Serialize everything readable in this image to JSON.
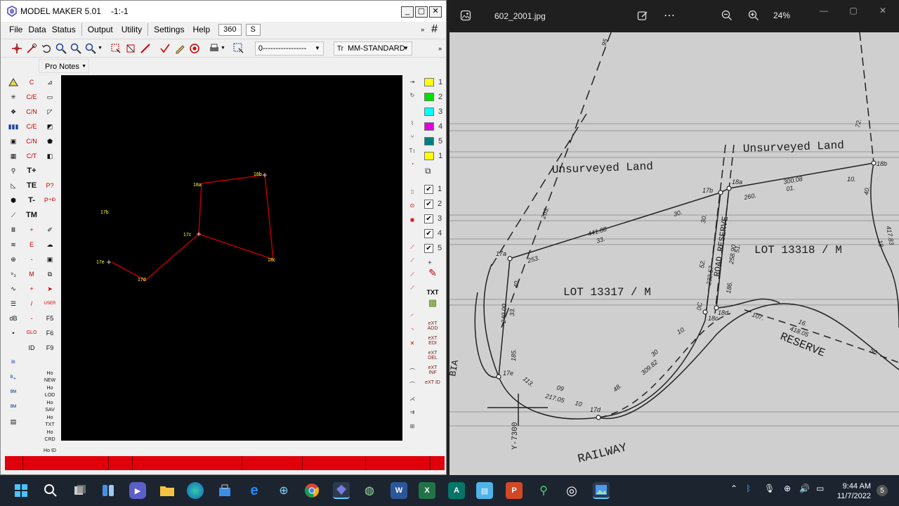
{
  "model_maker": {
    "title": "MODEL MAKER  5.01",
    "title_extra": "-1:-1",
    "window_buttons": [
      "_",
      "▢",
      "✕"
    ],
    "menu": [
      "File",
      "Data",
      "Status",
      "Output",
      "Utility",
      "Settings",
      "Help"
    ],
    "menu_box_1": "360",
    "menu_box_2": "S",
    "layer_combo": "0-----------------",
    "style_combo": "MM-STANDARD",
    "pro_notes": "Pro Notes",
    "left_tools_col2": [
      "C",
      "C/E",
      "C/N",
      "C/E",
      "C/N",
      "C/T",
      "T+",
      "TE",
      "T-",
      "TM",
      "+",
      "E",
      "-",
      "M",
      "+",
      "/",
      "-",
      "GLO",
      "ID"
    ],
    "left_tools_col3": [
      "Ho NEW",
      "Ho LOD",
      "Ho SAV",
      "Ho TXT",
      "Ho CRD",
      "Ho ID",
      "F5",
      "F6",
      "F9",
      "USER"
    ],
    "layer_colors": [
      {
        "n": "1",
        "color": "#ffff00"
      },
      {
        "n": "2",
        "color": "#00e000"
      },
      {
        "n": "3",
        "color": "#00ffff"
      },
      {
        "n": "4",
        "color": "#e000e0"
      },
      {
        "n": "5",
        "color": "#008080"
      },
      {
        "n": "1",
        "color": "#ffff00"
      }
    ],
    "layer_checks": [
      "1",
      "2",
      "3",
      "4",
      "5"
    ],
    "text_buttons": [
      "TXT",
      "eXT ADD",
      "eXT EDI",
      "eXT DEL",
      "eXT INF",
      "eXT ID"
    ],
    "points": [
      "18b",
      "18a",
      "17b",
      "17c",
      "18c",
      "17e",
      "17d"
    ]
  },
  "photo_viewer": {
    "filename": "602_2001.jpg",
    "zoom": "24%",
    "window_buttons": [
      "—",
      "▢",
      "✕"
    ],
    "plan": {
      "labels": {
        "unsurveyed_left": "Unsurveyed  Land",
        "unsurveyed_right": "Unsurveyed  Land",
        "lot_left": "LOT  13317 / M",
        "lot_right": "LOT  13318 / M",
        "road_reserve": "ROAD RESERVE",
        "reserve": "RESERVE",
        "railway": "RAILWAY",
        "bia": "BIA",
        "y_coord": "Y-7300"
      },
      "stations": [
        "17a",
        "17b",
        "18a",
        "18b",
        "17e",
        "17d",
        "18d",
        "18c"
      ],
      "dimensions": [
        "203.",
        "253.",
        "441.88",
        "33.",
        "30.",
        "300.08",
        "01.",
        "260.",
        "10.",
        "40.",
        "18",
        "417.83",
        "72.",
        "95",
        "52.",
        "232.57",
        "258.90",
        "51.",
        "186.",
        "30.",
        "0C",
        "10.",
        "309.82",
        "30",
        "48.",
        "217.05",
        "09",
        "10",
        "185.",
        "113.",
        "240.00",
        "33.",
        "40.",
        "107.",
        "418.05",
        "16.",
        "50."
      ]
    }
  },
  "taskbar": {
    "time": "9:44 AM",
    "date": "11/7/2022",
    "notification_count": "5"
  }
}
